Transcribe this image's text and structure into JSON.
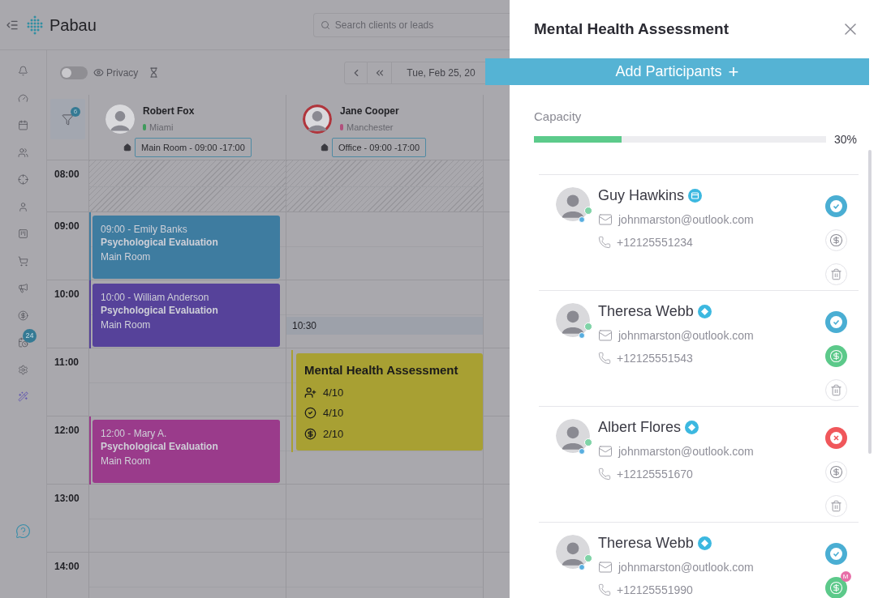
{
  "app": {
    "logo": "Pabau",
    "search": {
      "placeholder": "Search clients or leads"
    }
  },
  "sidebar": {
    "items": [
      {
        "kind": "bell"
      },
      {
        "kind": "gauge"
      },
      {
        "kind": "calendar"
      },
      {
        "kind": "users"
      },
      {
        "kind": "target"
      },
      {
        "kind": "user"
      },
      {
        "kind": "board"
      },
      {
        "kind": "cart"
      },
      {
        "kind": "megaphone"
      },
      {
        "kind": "dollar"
      },
      {
        "kind": "calendar-clock",
        "badge": "24"
      },
      {
        "kind": "settings"
      },
      {
        "kind": "wand"
      }
    ],
    "help": {
      "kind": "help"
    }
  },
  "toolbar": {
    "privacy": {
      "label": "Privacy",
      "on": false
    },
    "date": "Tue, Feb 25, 20"
  },
  "filter": {
    "badge": "6"
  },
  "staff": [
    {
      "name": "Robert Fox",
      "location": "Miami",
      "color": "#3f9a5c",
      "room": "Main Room - 09:00 -17:00",
      "highlighted": false
    },
    {
      "name": "Jane Cooper",
      "location": "Manchester",
      "color": "#b0507c",
      "room": "Office - 09:00 -17:00",
      "highlighted": true
    }
  ],
  "hours": [
    {
      "time": "08:00",
      "blocked": true,
      "cells": [
        null,
        null
      ]
    },
    {
      "time": "09:00",
      "blocked": false,
      "cells": [
        {
          "kind": "appointment",
          "title": "09:00 - Emily Banks",
          "service": "Psychological Evaluation",
          "room": "Main Room",
          "color": "#3e7ca0"
        },
        null
      ]
    },
    {
      "time": "10:00",
      "blocked": false,
      "cells": [
        {
          "kind": "appointment",
          "title": "10:00 - William Anderson",
          "service": "Psychological Evaluation",
          "room": "Main Room",
          "color": "#56429a"
        },
        {
          "kind": "slot",
          "title": "10:30"
        }
      ]
    },
    {
      "time": "11:00",
      "blocked": false,
      "cells": [
        null,
        {
          "kind": "group",
          "title": "Mental Health Assessment",
          "color": "#a8a033",
          "stats": [
            {
              "kind": "participants",
              "text": "4/10"
            },
            {
              "kind": "confirmed",
              "text": "4/10"
            },
            {
              "kind": "paid",
              "text": "2/10"
            }
          ]
        }
      ]
    },
    {
      "time": "12:00",
      "blocked": false,
      "cells": [
        {
          "kind": "appointment",
          "title": "12:00 - Mary A.",
          "service": "Psychological Evaluation",
          "room": "Main Room",
          "color": "#9a3b8b"
        },
        null
      ]
    },
    {
      "time": "13:00",
      "blocked": false,
      "cells": [
        null,
        null
      ]
    },
    {
      "time": "14:00",
      "blocked": false,
      "cells": [
        null,
        null
      ]
    }
  ],
  "drawer": {
    "title": "Mental Health Assessment",
    "add_button": "Add Participants",
    "add_icon": "+",
    "capacity": {
      "label": "Capacity",
      "level": 0.3,
      "reading": "30%"
    },
    "participants": [
      {
        "name": "Guy Hawkins",
        "badge": {
          "kind": "calendar"
        },
        "email": "johnmarston@outlook.com",
        "phone": "+12125551234",
        "confirmed": true,
        "paid": false
      },
      {
        "name": "Theresa Webb",
        "badge": {
          "kind": "diamond"
        },
        "email": "johnmarston@outlook.com",
        "phone": "+12125551543",
        "confirmed": true,
        "paid": true
      },
      {
        "name": "Albert Flores",
        "badge": {
          "kind": "diamond"
        },
        "email": "johnmarston@outlook.com",
        "phone": "+12125551670",
        "confirmed": false,
        "paid": false
      },
      {
        "name": "Theresa Webb",
        "badge": {
          "kind": "diamond"
        },
        "email": "johnmarston@outlook.com",
        "phone": "+12125551990",
        "confirmed": true,
        "paid": true,
        "paid_badge": "M"
      }
    ]
  }
}
